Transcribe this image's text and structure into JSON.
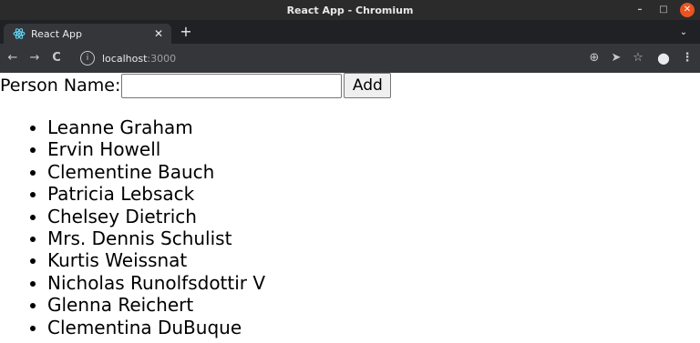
{
  "window": {
    "title": "React App - Chromium",
    "controls": {
      "minimize": "–",
      "maximize": "□",
      "close": "✕"
    }
  },
  "tabstrip": {
    "tabs": [
      {
        "title": "React App",
        "icon": "react-atom-icon",
        "close": "✕"
      }
    ],
    "new_tab": "+",
    "tab_menu": "⌄"
  },
  "toolbar": {
    "back": "←",
    "forward": "→",
    "reload": "C",
    "url_host": "localhost",
    "url_port": ":3000",
    "icons": {
      "zoom": "⊕",
      "send": "➤",
      "bookmark": "☆",
      "profile": "●",
      "menu": "⋮"
    }
  },
  "form": {
    "label": "Person Name:",
    "input_value": "",
    "input_placeholder": "",
    "button_label": "Add"
  },
  "people": [
    "Leanne Graham",
    "Ervin Howell",
    "Clementine Bauch",
    "Patricia Lebsack",
    "Chelsey Dietrich",
    "Mrs. Dennis Schulist",
    "Kurtis Weissnat",
    "Nicholas Runolfsdottir V",
    "Glenna Reichert",
    "Clementina DuBuque"
  ]
}
